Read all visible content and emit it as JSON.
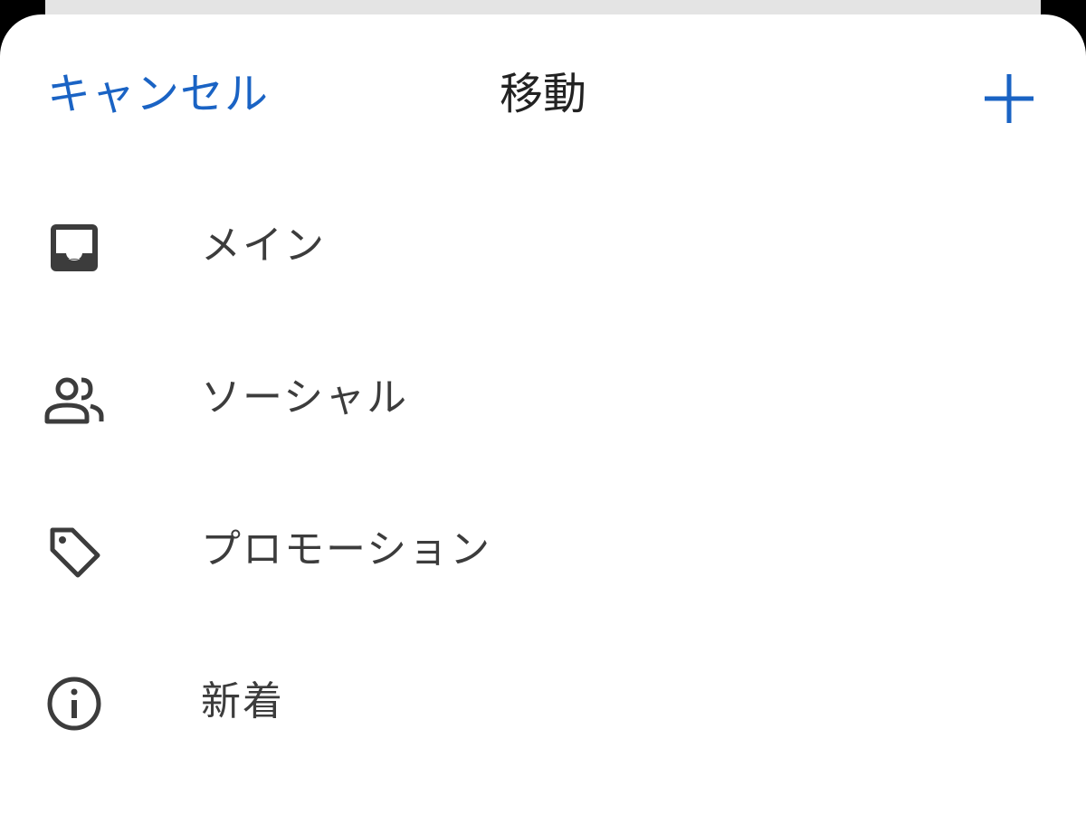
{
  "header": {
    "cancel_label": "キャンセル",
    "title": "移動",
    "add_icon": "plus-icon"
  },
  "menu": {
    "items": [
      {
        "label": "メイン",
        "icon": "inbox-icon"
      },
      {
        "label": "ソーシャル",
        "icon": "people-icon"
      },
      {
        "label": "プロモーション",
        "icon": "tag-icon"
      },
      {
        "label": "新着",
        "icon": "info-icon"
      }
    ]
  },
  "colors": {
    "accent": "#1a63c4",
    "text": "#3c3c3c",
    "title": "#222222",
    "icon": "#3c3c3c"
  }
}
